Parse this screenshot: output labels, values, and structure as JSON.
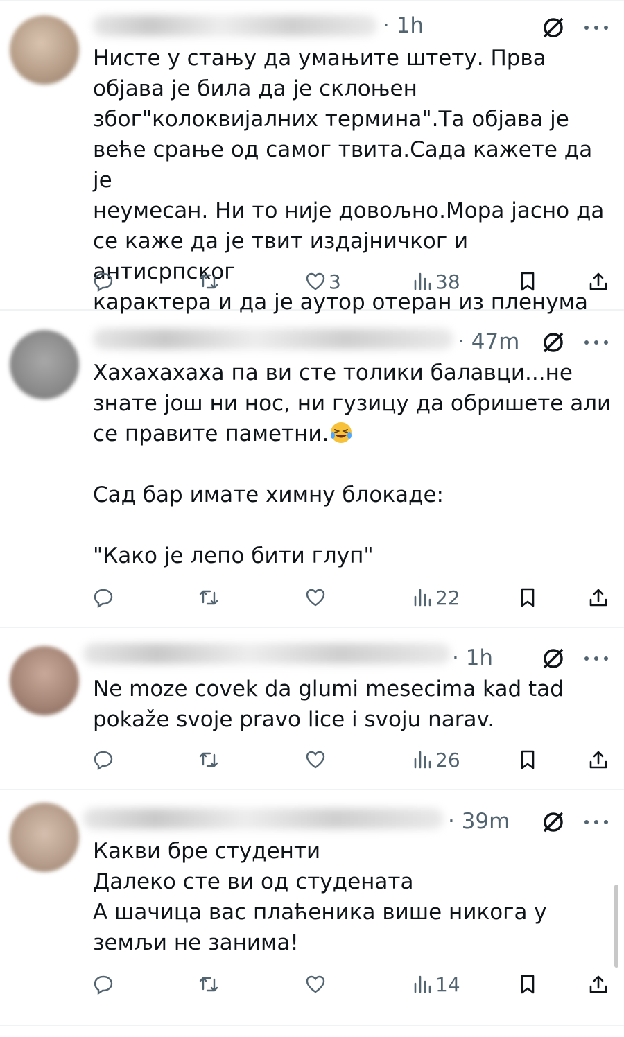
{
  "tweets": [
    {
      "handle_visible": "…ije",
      "time": "· 1h",
      "text": "Нисте у стању да умањите штету. Прва\nобјава је била да је склоњен\nзбог\"колоквијалних термина\".Та објава је\nвеће срање од самог твита.Сада кажете да је\nнеумесан. Ни то није довољно.Мора јасно да\nсе каже да је твит издајничког и антисрпског\nкарактера и да је аутор отеран из пленума",
      "text_suffix": "",
      "likes": "3",
      "views": "38"
    },
    {
      "handle_visible": "…",
      "time": "· 47m",
      "text": "Хахахахаха па ви сте толики балавци...не\nзнате још ни нос, ни гузицу да обришете али\nсе правите паметни.",
      "text_suffix": "\n\nСад бар имате химну блокаде:\n\n\"Како је лепо бити глуп\"",
      "likes": "",
      "views": "22"
    },
    {
      "handle_visible": "…",
      "time": "· 1h",
      "text": "Ne moze covek da glumi mesecima kad  tad\npokaže svoje pravo lice i svoju narav.",
      "text_suffix": "",
      "likes": "",
      "views": "26"
    },
    {
      "handle_visible": "…",
      "time": "· 39m",
      "text": "Какви бре студенти\nДалеко сте ви од студената\nА шачица вас плаћеника више никога у\nземљи не занима!",
      "text_suffix": "",
      "likes": "",
      "views": "14"
    }
  ],
  "icons": {
    "reply": "reply-icon",
    "retweet": "retweet-icon",
    "like": "heart-icon",
    "views": "views-icon",
    "bookmark": "bookmark-icon",
    "share": "share-icon",
    "grok": "grok-icon",
    "more": "more-icon"
  },
  "colors": {
    "text": "#0f1419",
    "secondary": "#536471",
    "divider": "#eff3f4"
  }
}
